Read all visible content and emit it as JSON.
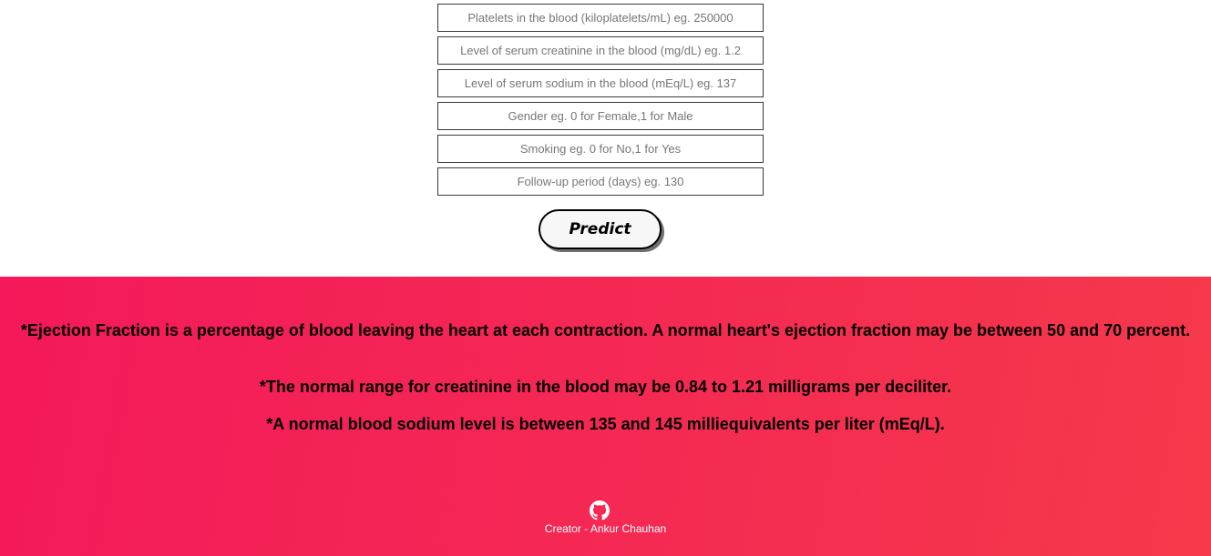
{
  "form": {
    "fields": [
      {
        "placeholder": "Platelets in the blood (kiloplatelets/mL) eg. 250000",
        "value": ""
      },
      {
        "placeholder": "Level of serum creatinine in the blood (mg/dL) eg. 1.2",
        "value": ""
      },
      {
        "placeholder": "Level of serum sodium in the blood (mEq/L) eg. 137",
        "value": ""
      },
      {
        "placeholder": "Gender eg. 0 for Female,1 for Male",
        "value": ""
      },
      {
        "placeholder": "Smoking eg. 0 for No,1 for Yes",
        "value": ""
      },
      {
        "placeholder": "Follow-up period (days) eg. 130",
        "value": ""
      }
    ],
    "predict_label": "Predict"
  },
  "info": {
    "notes": [
      "*Ejection Fraction is a percentage of blood leaving the heart at each contraction. A normal heart's ejection fraction may be between 50 and 70 percent.",
      "*The normal range for creatinine in the blood may be 0.84 to 1.21 milligrams per deciliter.",
      "*A normal blood sodium level is between 135 and 145 milliequivalents per liter (mEq/L)."
    ],
    "background_colors": [
      "#f4195a",
      "#f5394a"
    ]
  },
  "footer": {
    "icon": "github-icon",
    "creator": "Creator - Ankur Chauhan"
  }
}
